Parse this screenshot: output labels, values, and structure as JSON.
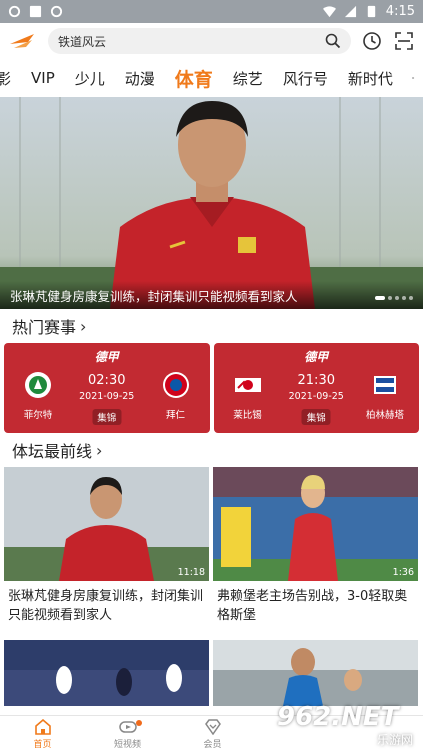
{
  "status_bar": {
    "time": "4:15"
  },
  "search": {
    "text": "铁道风云"
  },
  "tabs": [
    "影",
    "VIP",
    "少儿",
    "动漫",
    "体育",
    "综艺",
    "风行号",
    "新时代"
  ],
  "active_tab": "体育",
  "hero": {
    "caption": "张琳芃健身房康复训练，封闭集训只能视频看到家人"
  },
  "hot_matches": {
    "title": "热门赛事",
    "items": [
      {
        "league": "德甲",
        "time": "02:30",
        "date": "2021-09-25",
        "button": "集锦",
        "home": "菲尔特",
        "away": "拜仁"
      },
      {
        "league": "德甲",
        "time": "21:30",
        "date": "2021-09-25",
        "button": "集锦",
        "home": "莱比锡",
        "away": "柏林赫塔"
      }
    ]
  },
  "frontline": {
    "title": "体坛最前线",
    "cards": [
      {
        "duration": "11:18",
        "title": "张琳芃健身房康复训练，封闭集训只能视频看到家人"
      },
      {
        "duration": "1:36",
        "title": "弗赖堡老主场告别战，3-0轻取奥格斯堡"
      }
    ]
  },
  "bottom_nav": [
    {
      "label": "首页",
      "icon": "home-icon"
    },
    {
      "label": "短视频",
      "icon": "short-video-icon"
    },
    {
      "label": "会员",
      "icon": "vip-diamond-icon"
    }
  ],
  "watermark": {
    "big": "962.NET",
    "small": "乐游网"
  },
  "colors": {
    "accent": "#f07a1b",
    "match_card": "#c22a32"
  }
}
